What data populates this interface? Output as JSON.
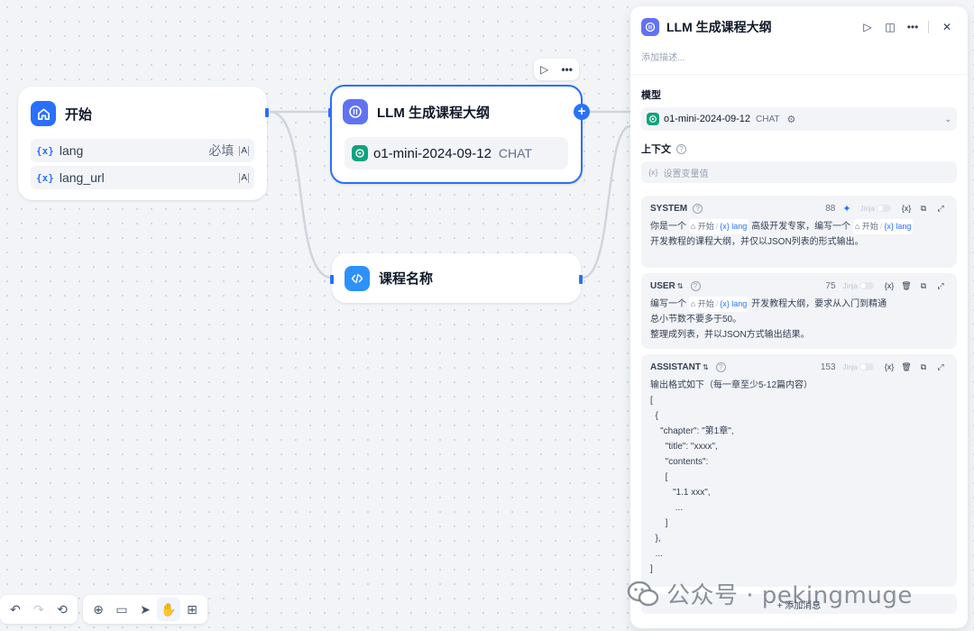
{
  "nodes": {
    "start": {
      "title": "开始",
      "variables": [
        {
          "name": "lang",
          "required": "必填",
          "type_icon": "text-type-icon"
        },
        {
          "name": "lang_url",
          "required": "",
          "type_icon": "text-type-icon"
        }
      ],
      "type_symbol": "A"
    },
    "llm": {
      "title": "LLM 生成课程大纲",
      "model": "o1-mini-2024-09-12",
      "mode": "CHAT"
    },
    "code": {
      "title": "课程名称"
    }
  },
  "var_symbol": "{x}",
  "panel": {
    "title": "LLM 生成课程大纲",
    "description_placeholder": "添加描述...",
    "model_label": "模型",
    "model_name": "o1-mini-2024-09-12",
    "model_mode": "CHAT",
    "context_label": "上下文",
    "context_placeholder": "设置变量值",
    "messages": [
      {
        "role": "SYSTEM",
        "count": "88",
        "jinja": "Jinja",
        "line1_a": "你是一个",
        "ref_node": "开始",
        "ref_var": "lang",
        "line1_b": "高级开发专家，编写一个",
        "line2": "开发教程的课程大纲，并仅以JSON列表的形式输出。"
      },
      {
        "role": "USER",
        "count": "75",
        "jinja": "Jinja",
        "line1_a": "编写一个",
        "ref_node": "开始",
        "ref_var": "lang",
        "line1_b": "开发教程大纲，要求从入门到精通",
        "line2": "总小节数不要多于50。",
        "line3": "整理成列表，并以JSON方式输出结果。"
      },
      {
        "role": "ASSISTANT",
        "count": "153",
        "jinja": "Jinja",
        "lines": [
          "输出格式如下（每一章至少5-12篇内容）",
          "[",
          "  {",
          "    \"chapter\": \"第1章\",",
          "      \"title\": \"xxxx\",",
          "      \"contents\":",
          "      [",
          "         \"1.1 xxx\",",
          "          ...",
          "      ]",
          "  },",
          "  ...",
          "]"
        ]
      }
    ],
    "add_message": "+ 添加消息"
  },
  "watermark": "公众号 · pekingmuge",
  "colors": {
    "accent": "#2970ff",
    "start_icon": "#2970ff",
    "llm_icon": "#6172f3",
    "code_icon": "#2e90fa",
    "gpt": "#10a37f"
  }
}
